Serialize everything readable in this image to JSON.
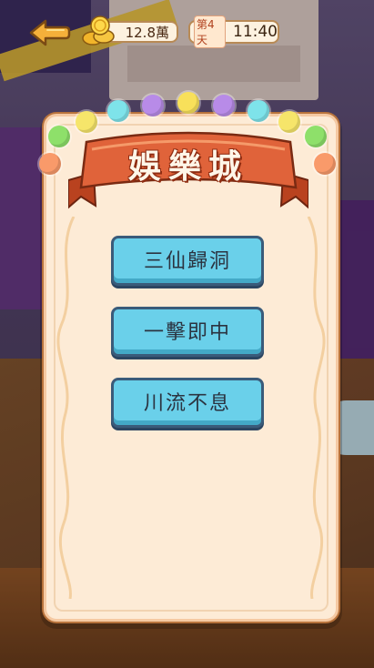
{
  "hud": {
    "coins": "12.8萬",
    "day": "第4天",
    "time": "11:40"
  },
  "panel": {
    "title": "娛樂城",
    "menu": [
      {
        "label": "三仙歸洞"
      },
      {
        "label": "一擊即中"
      },
      {
        "label": "川流不息"
      }
    ]
  },
  "colors": {
    "button": "#6ad0ea",
    "ribbon": "#e0633a",
    "panel": "#fdebd6"
  },
  "icons": {
    "back": "back-arrow-icon",
    "coins": "gold-coin-icon"
  }
}
